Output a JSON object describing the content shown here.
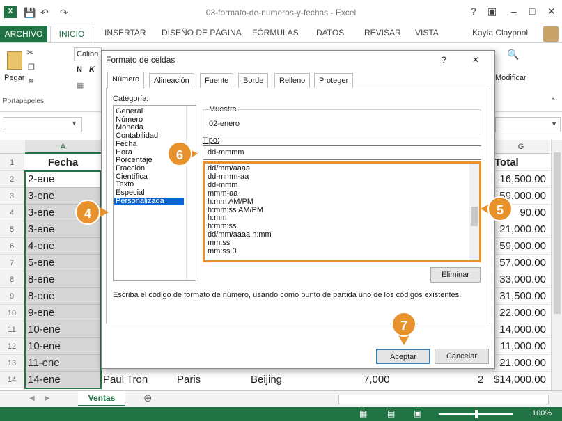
{
  "window": {
    "title": "03-formato-de-numeros-y-fechas - Excel",
    "help": "?",
    "ribbon_display": "▣",
    "minimize": "–",
    "maximize": "□",
    "close": "✕",
    "user": "Kayla Claypool"
  },
  "ribbon": {
    "tabs": [
      "ARCHIVO",
      "INICIO",
      "INSERTAR",
      "DISEÑO DE PÁGINA",
      "FÓRMULAS",
      "DATOS",
      "REVISAR",
      "VISTA"
    ],
    "paste_label": "Pegar",
    "font_name": "Calibri",
    "bold": "N",
    "italic": "K",
    "clipboard_group": "Portapapeles",
    "modify_label": "Modificar"
  },
  "sheet": {
    "col_a": "A",
    "col_g": "G",
    "header_fecha": "Fecha",
    "header_total": "Total",
    "rows": [
      {
        "n": "1",
        "a": "",
        "g": ""
      },
      {
        "n": "2",
        "a": "2-ene",
        "g": "16,500.00"
      },
      {
        "n": "3",
        "a": "3-ene",
        "g": "59,000.00"
      },
      {
        "n": "4",
        "a": "3-ene",
        "g": "90.00"
      },
      {
        "n": "5",
        "a": "3-ene",
        "g": "21,000.00"
      },
      {
        "n": "6",
        "a": "4-ene",
        "g": "59,000.00"
      },
      {
        "n": "7",
        "a": "5-ene",
        "g": "57,000.00"
      },
      {
        "n": "8",
        "a": "8-ene",
        "g": "33,000.00"
      },
      {
        "n": "9",
        "a": "8-ene",
        "g": "31,500.00"
      },
      {
        "n": "10",
        "a": "9-ene",
        "g": "22,000.00"
      },
      {
        "n": "11",
        "a": "10-ene",
        "g": "14,000.00"
      },
      {
        "n": "12",
        "a": "10-ene",
        "g": "11,000.00"
      },
      {
        "n": "13",
        "a": "11-ene",
        "g": "21,000.00"
      },
      {
        "n": "14",
        "a": "14-ene",
        "g": "$14,000.00"
      }
    ],
    "row14": {
      "b": "Paul Tron",
      "c": "Paris",
      "d": "Beijing",
      "e": "7,000",
      "f": "2"
    },
    "sheet_tab": "Ventas",
    "zoom": "100%"
  },
  "dialog": {
    "title": "Formato de celdas",
    "help": "?",
    "close": "✕",
    "tabs": [
      "Número",
      "Alineación",
      "Fuente",
      "Borde",
      "Relleno",
      "Proteger"
    ],
    "category_label": "Categoría:",
    "categories": [
      "General",
      "Número",
      "Moneda",
      "Contabilidad",
      "Fecha",
      "Hora",
      "Porcentaje",
      "Fracción",
      "Científica",
      "Texto",
      "Especial",
      "Personalizada"
    ],
    "selected_category": "Personalizada",
    "sample_label": "Muestra",
    "sample_value": "02-enero",
    "type_label": "Tipo:",
    "type_value": "dd-mmmm",
    "formats": [
      "dd/mm/aaaa",
      "dd-mmm-aa",
      "dd-mmm",
      "mmm-aa",
      "h:mm AM/PM",
      "h:mm:ss AM/PM",
      "h:mm",
      "h:mm:ss",
      "dd/mm/aaaa h:mm",
      "mm:ss",
      "mm:ss.0"
    ],
    "delete_button": "Eliminar",
    "description": "Escriba el código de formato de número, usando como punto de partida uno de los códigos existentes.",
    "ok_button": "Aceptar",
    "cancel_button": "Cancelar"
  },
  "callouts": [
    "4",
    "5",
    "6",
    "7"
  ],
  "colors": {
    "excel_green": "#217346",
    "callout_orange": "#e8922e",
    "selection_blue": "#0a64d2"
  }
}
